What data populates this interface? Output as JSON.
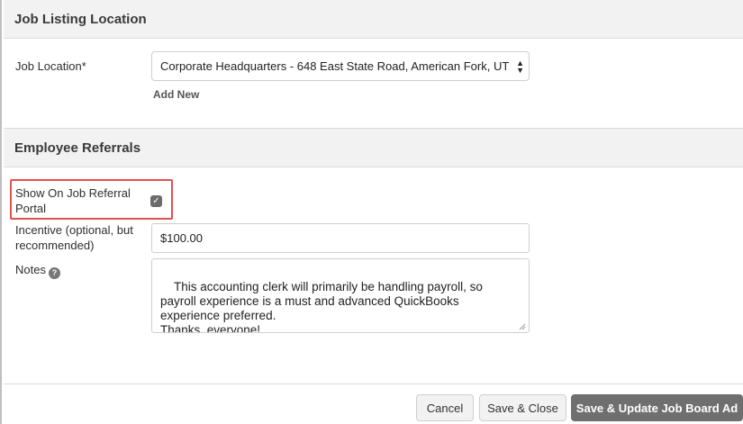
{
  "sections": {
    "location_title": "Job Listing Location",
    "referrals_title": "Employee Referrals"
  },
  "location": {
    "label": "Job Location*",
    "selected_value": "Corporate Headquarters - 648 East State Road, American Fork, UT",
    "add_new": "Add New"
  },
  "referrals": {
    "show_portal_label_line1": "Show On Job Referral",
    "show_portal_label_line2": "Portal",
    "show_portal_checked": true,
    "incentive_label_line1": "Incentive (optional, but",
    "incentive_label_line2": "recommended)",
    "incentive_value": "$100.00",
    "notes_label": "Notes",
    "notes_value": "This accounting clerk will primarily be handling payroll, so\npayroll experience is a must and advanced QuickBooks\nexperience preferred.\nThanks, everyone!"
  },
  "icons": {
    "select_arrows": "select-arrows-icon",
    "help": "question-circle-icon",
    "check": "check-icon",
    "resize": "resize-grip-icon"
  },
  "footer": {
    "cancel": "Cancel",
    "save_close": "Save & Close",
    "save_update": "Save & Update Job Board Ad"
  },
  "colors": {
    "highlight": "#e0524f",
    "primary_button": "#6f6f6f",
    "section_bg": "#f2f2f2"
  }
}
